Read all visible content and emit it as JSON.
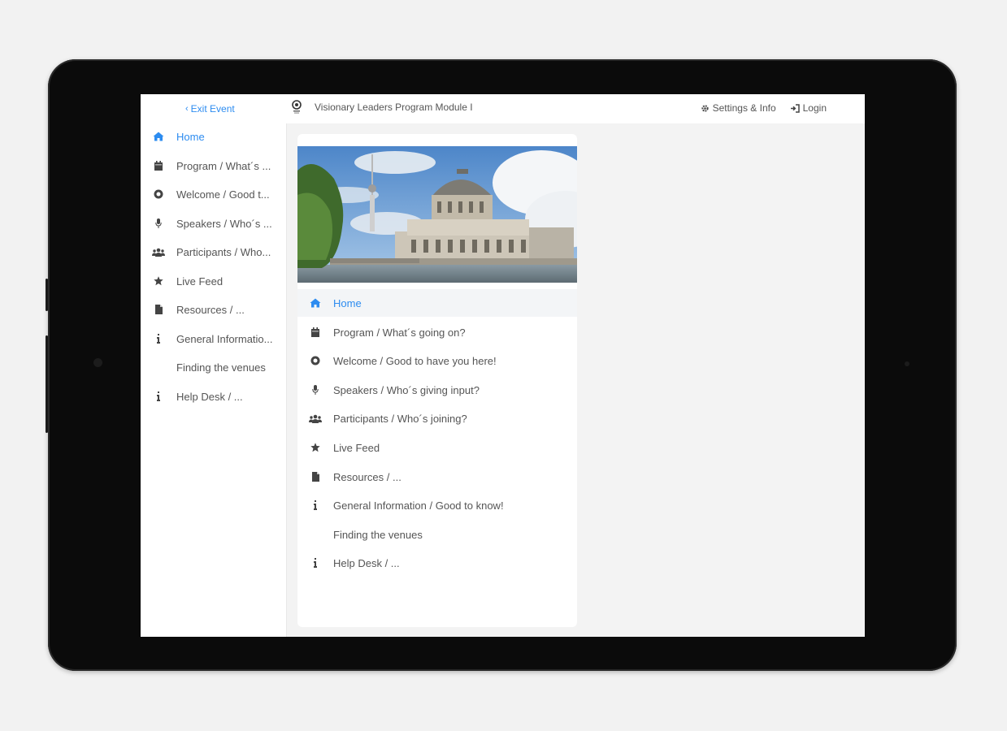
{
  "topbar": {
    "exit_label": "Exit Event",
    "event_title": "Visionary Leaders Program Module I",
    "settings_label": "Settings & Info",
    "login_label": "Login"
  },
  "menu": [
    {
      "label": "Home",
      "icon": "home-icon",
      "active": true
    },
    {
      "label": "Program / What´s going on?",
      "icon": "calendar-icon",
      "active": false
    },
    {
      "label": "Welcome / Good to have you here!",
      "icon": "circle-icon",
      "active": false
    },
    {
      "label": "Speakers / Who´s giving input?",
      "icon": "microphone-icon",
      "active": false
    },
    {
      "label": "Participants / Who´s joining?",
      "icon": "users-icon",
      "active": false
    },
    {
      "label": "Live Feed",
      "icon": "star-icon",
      "active": false
    },
    {
      "label": "Resources / ...",
      "icon": "file-icon",
      "active": false
    },
    {
      "label": "General Information / Good to know!",
      "icon": "info-icon",
      "active": false
    },
    {
      "label": "Finding the venues",
      "icon": "",
      "active": false
    },
    {
      "label": "Help Desk / ...",
      "icon": "info-icon",
      "active": false
    }
  ],
  "sidebar_labels": [
    "Home",
    "Program / What´s ...",
    "Welcome / Good t...",
    "Speakers / Who´s ...",
    "Participants / Who...",
    "Live Feed",
    "Resources / ...",
    "General Informatio...",
    "Finding the venues",
    "Help Desk / ..."
  ],
  "colors": {
    "accent": "#2d8cf0",
    "text": "#555555",
    "background": "#f3f3f3"
  }
}
